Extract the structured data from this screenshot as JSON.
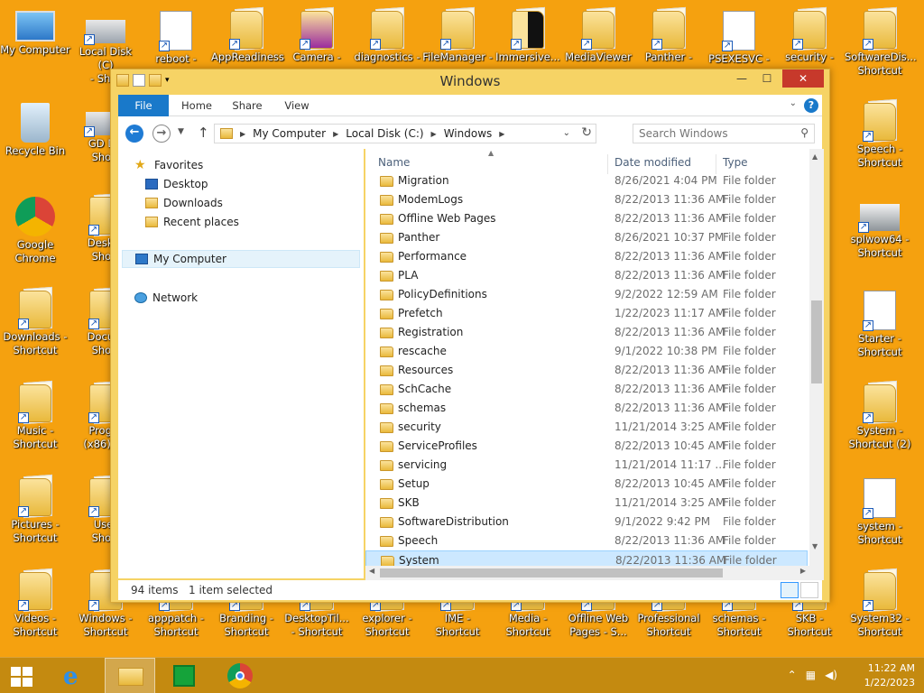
{
  "desktop": {
    "icons": [
      {
        "label": "My Computer",
        "kind": "computer"
      },
      {
        "label": "Local Disk (C)\n- Shor",
        "kind": "disk"
      },
      {
        "label": "reboot -",
        "kind": "settings"
      },
      {
        "label": "AppReadiness",
        "kind": "folder"
      },
      {
        "label": "Camera -",
        "kind": "folder-purple"
      },
      {
        "label": "diagnostics -",
        "kind": "folder"
      },
      {
        "label": "FileManager -",
        "kind": "folder"
      },
      {
        "label": "Immersive...",
        "kind": "folder-black"
      },
      {
        "label": "MediaViewer",
        "kind": "folder"
      },
      {
        "label": "Panther -",
        "kind": "folder"
      },
      {
        "label": "PSEXESVC -",
        "kind": "window"
      },
      {
        "label": "security -",
        "kind": "folder"
      },
      {
        "label": "SoftwareDis...\nShortcut",
        "kind": "folder"
      },
      {
        "label": "Recycle Bin",
        "kind": "recycle"
      },
      {
        "label": "GD Dri\nShort",
        "kind": "disk"
      },
      {
        "label": "Speech -\nShortcut",
        "kind": "folder"
      },
      {
        "label": "Google\nChrome",
        "kind": "chrome"
      },
      {
        "label": "Deskto\nShort",
        "kind": "folder"
      },
      {
        "label": "splwow64 -\nShortcut",
        "kind": "printer"
      },
      {
        "label": "Downloads -\nShortcut",
        "kind": "folder-download"
      },
      {
        "label": "Docum\nShort",
        "kind": "folder"
      },
      {
        "label": "Starter -\nShortcut",
        "kind": "document"
      },
      {
        "label": "Music -\nShortcut",
        "kind": "folder-music"
      },
      {
        "label": "Progra\n(x86) - S",
        "kind": "folder"
      },
      {
        "label": "System -\nShortcut (2)",
        "kind": "folder"
      },
      {
        "label": "Pictures -\nShortcut",
        "kind": "folder-pictures"
      },
      {
        "label": "User\nShort",
        "kind": "folder"
      },
      {
        "label": "system -\nShortcut",
        "kind": "settings-doc"
      },
      {
        "label": "Videos -\nShortcut",
        "kind": "folder-video"
      },
      {
        "label": "Windows -\nShortcut",
        "kind": "folder"
      },
      {
        "label": "apppatch -\nShortcut",
        "kind": "folder"
      },
      {
        "label": "Branding -\nShortcut",
        "kind": "folder"
      },
      {
        "label": "DesktopTil...\n- Shortcut",
        "kind": "folder"
      },
      {
        "label": "explorer -\nShortcut",
        "kind": "folder"
      },
      {
        "label": "IME -\nShortcut",
        "kind": "folder"
      },
      {
        "label": "Media -\nShortcut",
        "kind": "folder"
      },
      {
        "label": "Offline Web\nPages - S...",
        "kind": "folder"
      },
      {
        "label": "Professional\nShortcut",
        "kind": "folder"
      },
      {
        "label": "schemas -\nShortcut",
        "kind": "folder"
      },
      {
        "label": "SKB -\nShortcut",
        "kind": "folder"
      },
      {
        "label": "System32 -\nShortcut",
        "kind": "folder"
      }
    ]
  },
  "window": {
    "title": "Windows",
    "controls": {
      "minimize": "—",
      "maximize": "☐",
      "close": "✕"
    },
    "ribbon": {
      "tabs": [
        "File",
        "Home",
        "Share",
        "View"
      ],
      "help": "?"
    },
    "address": {
      "crumbs": [
        "My Computer",
        "Local Disk (C:)",
        "Windows"
      ],
      "search_placeholder": "Search Windows"
    },
    "nav": {
      "favorites_label": "Favorites",
      "favorites": [
        "Desktop",
        "Downloads",
        "Recent places"
      ],
      "computer_label": "My Computer",
      "network_label": "Network"
    },
    "columns": {
      "name": "Name",
      "date": "Date modified",
      "type": "Type"
    },
    "files": [
      {
        "name": "Migration",
        "date": "8/26/2021 4:04 PM",
        "type": "File folder"
      },
      {
        "name": "ModemLogs",
        "date": "8/22/2013 11:36 AM",
        "type": "File folder"
      },
      {
        "name": "Offline Web Pages",
        "date": "8/22/2013 11:36 AM",
        "type": "File folder"
      },
      {
        "name": "Panther",
        "date": "8/26/2021 10:37 PM",
        "type": "File folder"
      },
      {
        "name": "Performance",
        "date": "8/22/2013 11:36 AM",
        "type": "File folder"
      },
      {
        "name": "PLA",
        "date": "8/22/2013 11:36 AM",
        "type": "File folder"
      },
      {
        "name": "PolicyDefinitions",
        "date": "9/2/2022 12:59 AM",
        "type": "File folder"
      },
      {
        "name": "Prefetch",
        "date": "1/22/2023 11:17 AM",
        "type": "File folder"
      },
      {
        "name": "Registration",
        "date": "8/22/2013 11:36 AM",
        "type": "File folder"
      },
      {
        "name": "rescache",
        "date": "9/1/2022 10:38 PM",
        "type": "File folder"
      },
      {
        "name": "Resources",
        "date": "8/22/2013 11:36 AM",
        "type": "File folder"
      },
      {
        "name": "SchCache",
        "date": "8/22/2013 11:36 AM",
        "type": "File folder"
      },
      {
        "name": "schemas",
        "date": "8/22/2013 11:36 AM",
        "type": "File folder"
      },
      {
        "name": "security",
        "date": "11/21/2014 3:25 AM",
        "type": "File folder"
      },
      {
        "name": "ServiceProfiles",
        "date": "8/22/2013 10:45 AM",
        "type": "File folder"
      },
      {
        "name": "servicing",
        "date": "11/21/2014 11:17 ...",
        "type": "File folder"
      },
      {
        "name": "Setup",
        "date": "8/22/2013 10:45 AM",
        "type": "File folder"
      },
      {
        "name": "SKB",
        "date": "11/21/2014 3:25 AM",
        "type": "File folder"
      },
      {
        "name": "SoftwareDistribution",
        "date": "9/1/2022 9:42 PM",
        "type": "File folder"
      },
      {
        "name": "Speech",
        "date": "8/22/2013 11:36 AM",
        "type": "File folder"
      },
      {
        "name": "System",
        "date": "8/22/2013 11:36 AM",
        "type": "File folder",
        "selected": true
      }
    ],
    "status": {
      "count": "94 items",
      "selection": "1 item selected"
    }
  },
  "taskbar": {
    "time": "11:22 AM",
    "date": "1/22/2023",
    "accent": "#c48a10"
  },
  "colors": {
    "desktop": "#f5a10f",
    "selection": "#cce8ff",
    "file_tab": "#1979ca",
    "close": "#c7392b"
  }
}
